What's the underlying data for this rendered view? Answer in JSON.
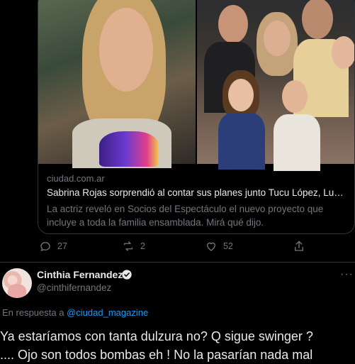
{
  "link_card": {
    "domain": "ciudad.com.ar",
    "title": "Sabrina Rojas sorprendió al contar sus planes junto Tucu López, Lucia...",
    "description": "La actriz reveló en Socios del Espectáculo el nuevo proyecto que incluye a toda la familia ensamblada. Mirá qué dijo."
  },
  "actions": {
    "reply_count": "27",
    "retweet_count": "2",
    "like_count": "52"
  },
  "reply_tweet": {
    "author_name": "Cinthia Fernandez",
    "author_handle": "@cinthifernandez",
    "reply_prefix": "En respuesta a",
    "reply_to_handle": "@ciudad_magazine",
    "text_line1": "Ya estaríamos con tanta dulzura no? Q sigue swinger ?",
    "text_line2": ".... Ojo son todos bombas eh ! No la pasarían nada mal"
  },
  "colors": {
    "background": "#000000",
    "text": "#e7e9ea",
    "secondary": "#71767b",
    "link": "#1d9bf0",
    "border": "#2f3336"
  },
  "icons": [
    "reply-icon",
    "retweet-icon",
    "like-icon",
    "share-icon",
    "verified-badge-icon",
    "more-icon"
  ]
}
